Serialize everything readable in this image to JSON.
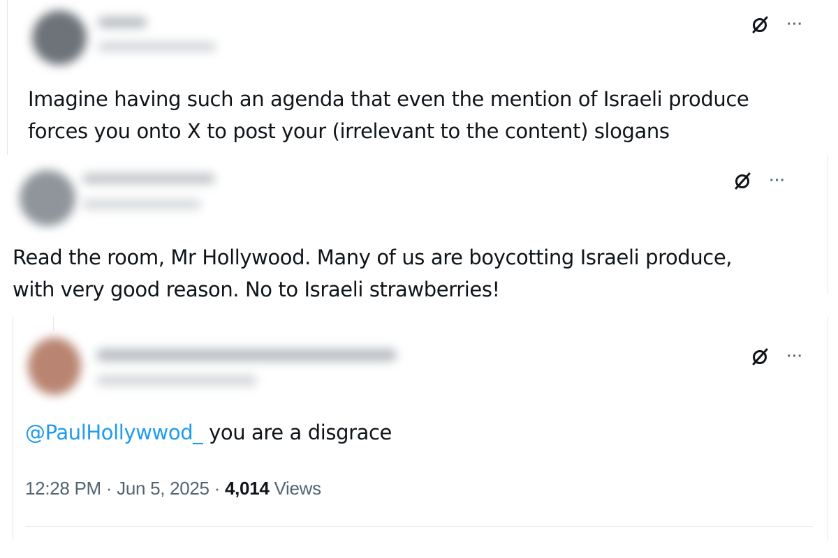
{
  "tweets": [
    {
      "text": "Imagine having such an agenda that even the mention of Israeli produce forces you onto X to post your (irrelevant to the content) slogans",
      "line1": "Imagine having such an agenda that even the mention of Israeli produce",
      "line2": "forces you onto X to post your (irrelevant to the content) slogans"
    },
    {
      "text": "Read the room, Mr Hollywood. Many of us are boycotting Israeli produce, with very good reason. No to Israeli strawberries!",
      "line1": "Read the room, Mr Hollywood. Many of us are boycotting Israeli produce,",
      "line2": "with very good reason. No to Israeli strawberries!"
    },
    {
      "mention": "@PaulHollywwod_",
      "text": " you are a disgrace",
      "time": "12:28 PM",
      "sep": "·",
      "date": "Jun 5, 2025",
      "views_count": "4,014",
      "views_label": "Views"
    }
  ],
  "icons": {
    "grok": "grok-icon",
    "more": "more-icon"
  },
  "colors": {
    "mention": "#1d9bf0",
    "meta": "#536471",
    "text": "#0f1419"
  }
}
